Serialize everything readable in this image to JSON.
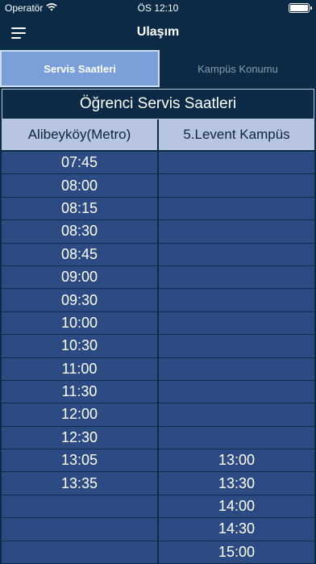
{
  "status": {
    "carrier": "Operatör",
    "time": "ÖS 12:10"
  },
  "nav": {
    "title": "Ulaşım"
  },
  "tabs": [
    {
      "label": "Servis Saatleri",
      "active": true
    },
    {
      "label": "Kampüs Konumu",
      "active": false
    }
  ],
  "table": {
    "title": "Öğrenci Servis Saatleri",
    "columns": [
      "Alibeyköy(Metro)",
      "5.Levent Kampüs"
    ],
    "rows": [
      [
        "07:45",
        ""
      ],
      [
        "08:00",
        ""
      ],
      [
        "08:15",
        ""
      ],
      [
        "08:30",
        ""
      ],
      [
        "08:45",
        ""
      ],
      [
        "09:00",
        ""
      ],
      [
        "09:30",
        ""
      ],
      [
        "10:00",
        ""
      ],
      [
        "10:30",
        ""
      ],
      [
        "11:00",
        ""
      ],
      [
        "11:30",
        ""
      ],
      [
        "12:00",
        ""
      ],
      [
        "12:30",
        ""
      ],
      [
        "13:05",
        "13:00"
      ],
      [
        "13:35",
        "13:30"
      ],
      [
        "",
        "14:00"
      ],
      [
        "",
        "14:30"
      ],
      [
        "",
        "15:00"
      ]
    ]
  },
  "colors": {
    "background": "#0b2a45",
    "active_tab": "#7b9fd9",
    "header": "#b7c5e0",
    "cell": "#2c4b82"
  }
}
